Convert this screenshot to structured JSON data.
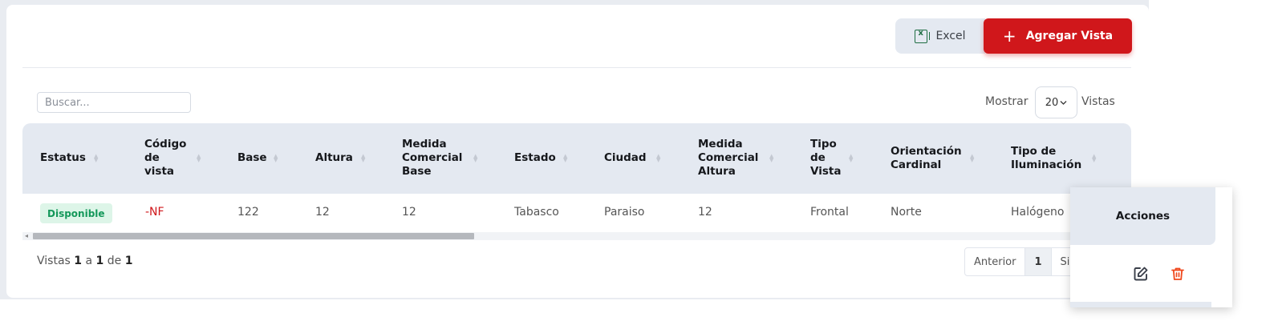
{
  "toolbar": {
    "excel_label": "Excel",
    "add_label": "Agregar Vista",
    "add_icon": "+"
  },
  "search": {
    "placeholder": "Buscar..."
  },
  "length": {
    "prefix": "Mostrar",
    "value": "20",
    "suffix": "Vistas"
  },
  "table": {
    "headers": {
      "estatus": "Estatus",
      "codigo_1": "Código",
      "codigo_2": "de",
      "codigo_3": "vista",
      "base": "Base",
      "altura": "Altura",
      "medida_base_1": "Medida",
      "medida_base_2": "Comercial",
      "medida_base_3": "Base",
      "estado": "Estado",
      "ciudad": "Ciudad",
      "medida_alt_1": "Medida",
      "medida_alt_2": "Comercial",
      "medida_alt_3": "Altura",
      "tipo_vista_1": "Tipo",
      "tipo_vista_2": "de",
      "tipo_vista_3": "Vista",
      "orient_1": "Orientación",
      "orient_2": "Cardinal",
      "ilum_1": "Tipo de",
      "ilum_2": "Iluminación",
      "acciones": "Acciones"
    },
    "row": {
      "estatus": "Disponible",
      "codigo": "-NF",
      "base": "122",
      "altura": "12",
      "medida_base": "12",
      "estado": "Tabasco",
      "ciudad": "Paraiso",
      "medida_altura": "12",
      "tipo_vista": "Frontal",
      "orientacion": "Norte",
      "iluminacion": "Halógeno"
    }
  },
  "footer": {
    "prefix": "Vistas",
    "from": "1",
    "sep": "a",
    "to": "1",
    "of": "de",
    "total": "1"
  },
  "pagination": {
    "prev": "Anterior",
    "current": "1",
    "next": "Si"
  },
  "colors": {
    "accent": "#d0171b",
    "badge_bg": "#ddf5e8",
    "badge_text": "#14985a",
    "header_bg": "#e4e9f1"
  },
  "icons": {
    "excel": "excel-icon",
    "edit": "edit-icon",
    "delete": "trash-icon",
    "sort": "sort-icon"
  }
}
